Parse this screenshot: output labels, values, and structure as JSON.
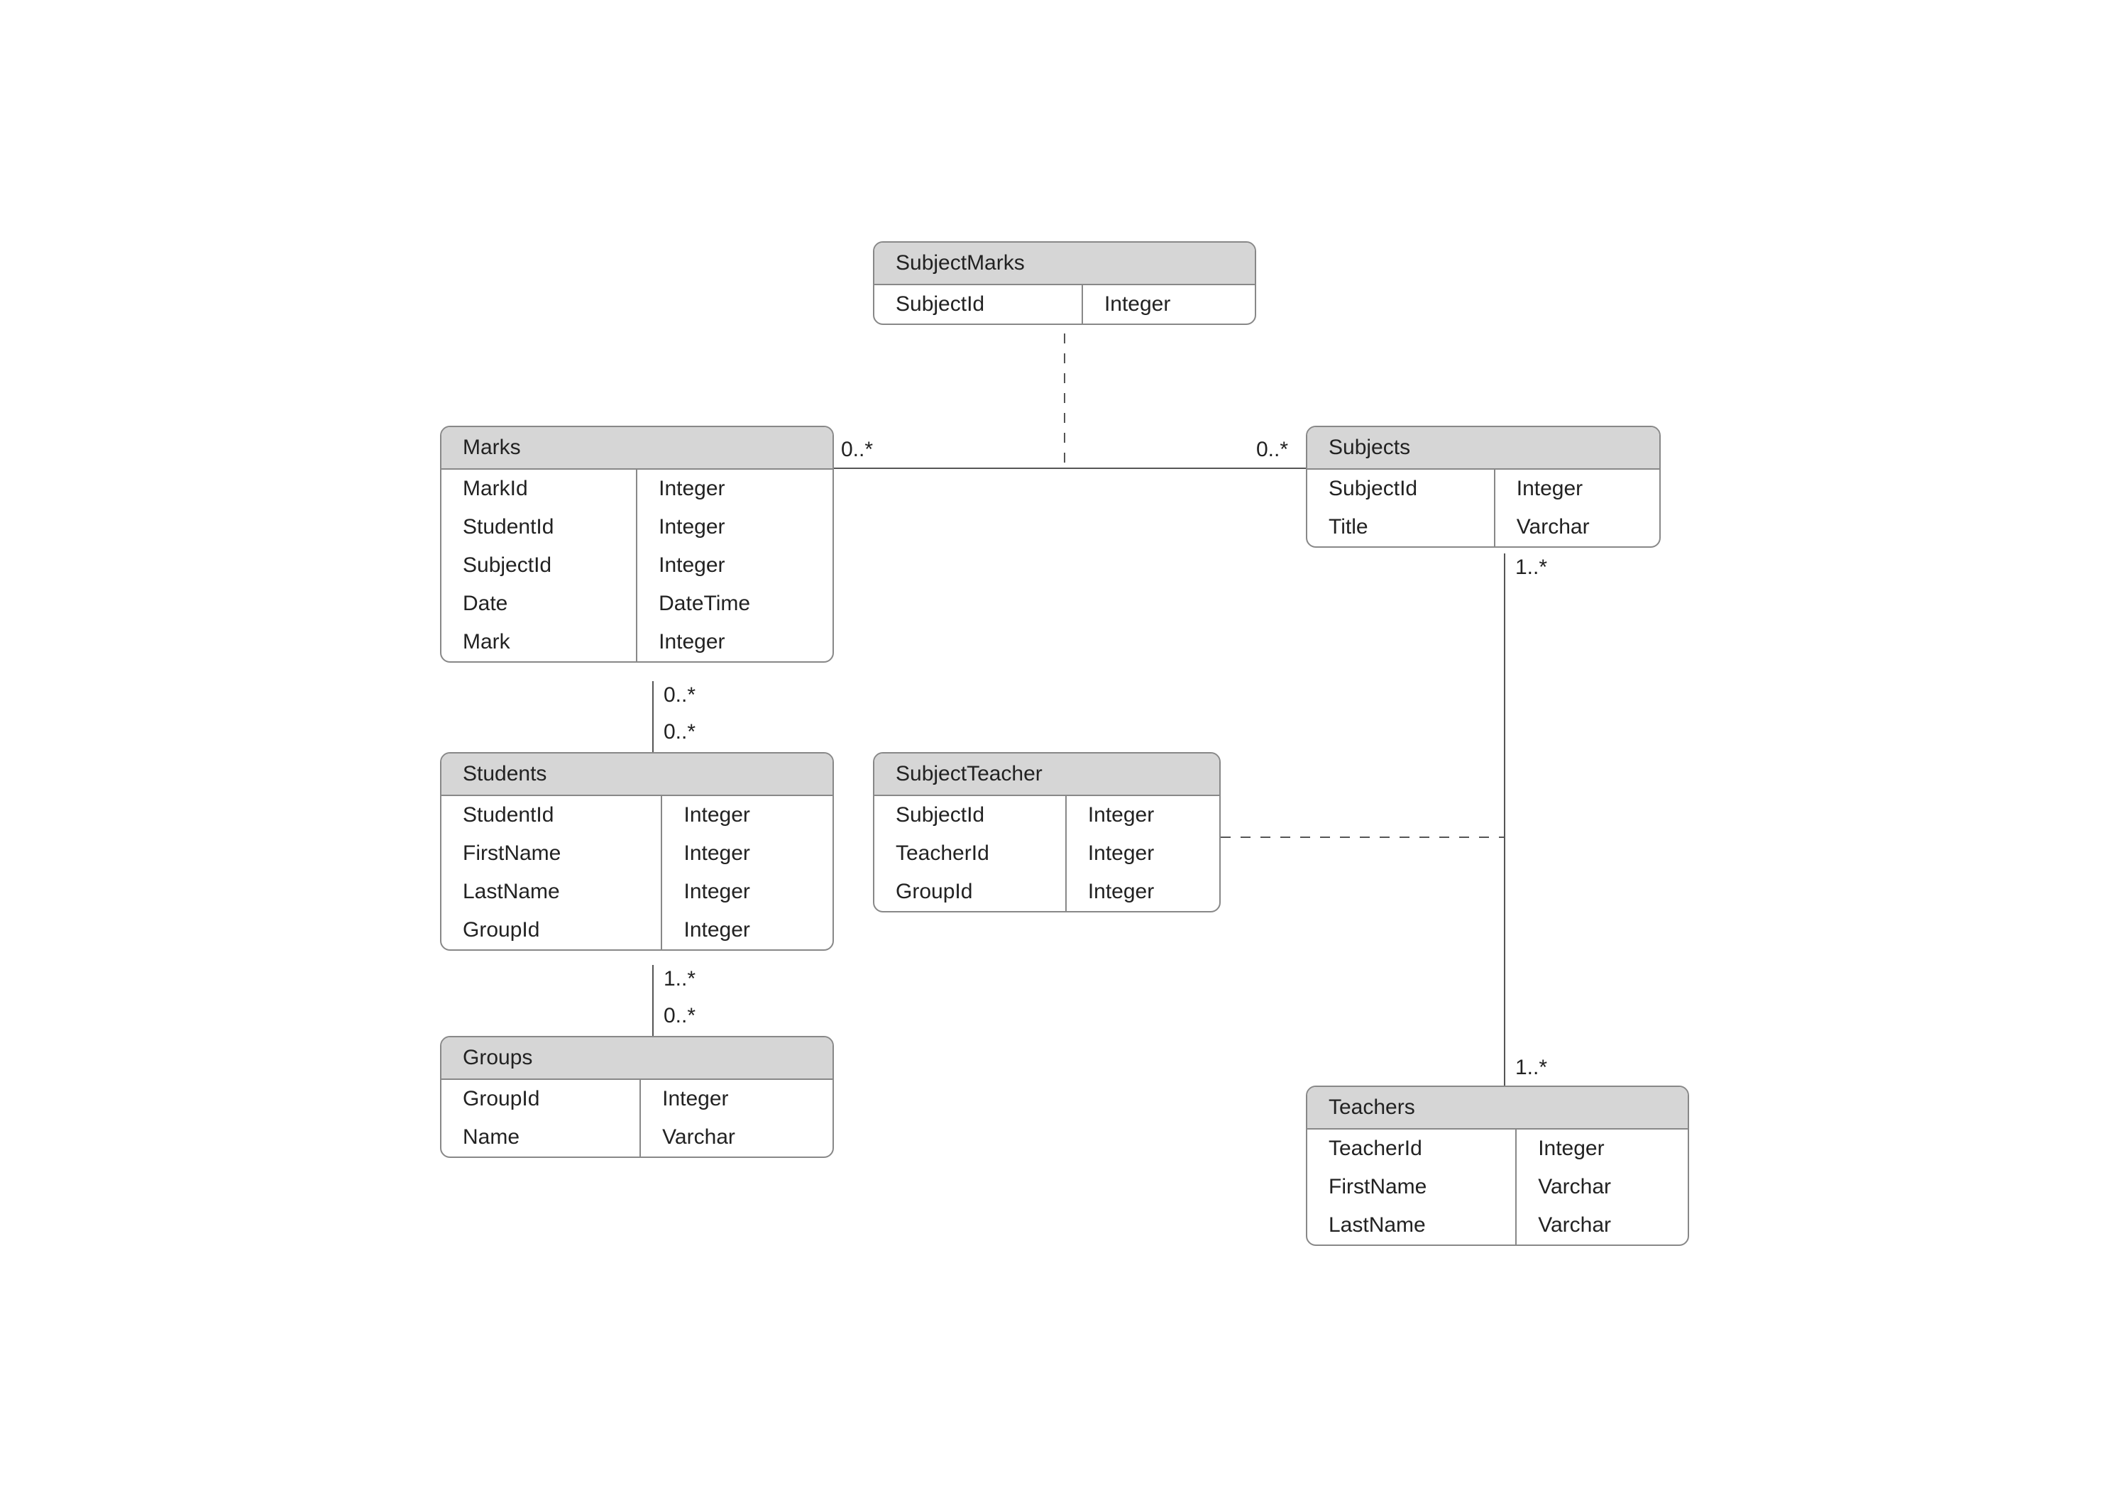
{
  "entities": {
    "subjectMarks": {
      "title": "SubjectMarks",
      "fields": [
        {
          "name": "SubjectId",
          "type": "Integer"
        }
      ]
    },
    "marks": {
      "title": "Marks",
      "fields": [
        {
          "name": "MarkId",
          "type": "Integer"
        },
        {
          "name": "StudentId",
          "type": "Integer"
        },
        {
          "name": "SubjectId",
          "type": "Integer"
        },
        {
          "name": "Date",
          "type": "DateTime"
        },
        {
          "name": "Mark",
          "type": "Integer"
        }
      ]
    },
    "subjects": {
      "title": "Subjects",
      "fields": [
        {
          "name": "SubjectId",
          "type": "Integer"
        },
        {
          "name": "Title",
          "type": "Varchar"
        }
      ]
    },
    "students": {
      "title": "Students",
      "fields": [
        {
          "name": "StudentId",
          "type": "Integer"
        },
        {
          "name": "FirstName",
          "type": "Integer"
        },
        {
          "name": "LastName",
          "type": "Integer"
        },
        {
          "name": "GroupId",
          "type": "Integer"
        }
      ]
    },
    "subjectTeacher": {
      "title": "SubjectTeacher",
      "fields": [
        {
          "name": "SubjectId",
          "type": "Integer"
        },
        {
          "name": "TeacherId",
          "type": "Integer"
        },
        {
          "name": "GroupId",
          "type": "Integer"
        }
      ]
    },
    "groups": {
      "title": "Groups",
      "fields": [
        {
          "name": "GroupId",
          "type": "Integer"
        },
        {
          "name": "Name",
          "type": "Varchar"
        }
      ]
    },
    "teachers": {
      "title": "Teachers",
      "fields": [
        {
          "name": "TeacherId",
          "type": "Integer"
        },
        {
          "name": "FirstName",
          "type": "Varchar"
        },
        {
          "name": "LastName",
          "type": "Varchar"
        }
      ]
    }
  },
  "multiplicities": {
    "marksToSubjects_left": "0..*",
    "marksToSubjects_right": "0..*",
    "subjectsToTeachers_top": "1..*",
    "subjectsToTeachers_bottom": "1..*",
    "marksToStudents_top": "0..*",
    "marksToStudents_bottom": "0..*",
    "studentsToGroups_top": "1..*",
    "studentsToGroups_bottom": "0..*"
  }
}
